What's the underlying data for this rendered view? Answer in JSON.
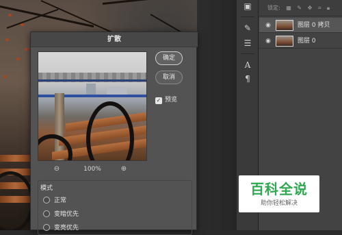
{
  "dialog": {
    "title": "扩散",
    "ok_label": "确定",
    "cancel_label": "取消",
    "preview_label": "预览",
    "preview_checked": true,
    "zoom_value": "100%",
    "mode": {
      "title": "模式",
      "options": [
        "正常",
        "变暗优先",
        "变亮优先"
      ]
    }
  },
  "layers_panel": {
    "lock_label": "锁定:",
    "layers": [
      {
        "name": "图层 0 拷贝",
        "visible": true,
        "selected": true
      },
      {
        "name": "图层 0",
        "visible": true,
        "selected": false
      }
    ]
  },
  "tools": {
    "icons": [
      "layer-comps-icon",
      "brush-settings-icon",
      "adjustments-icon",
      "character-icon",
      "paragraph-icon"
    ]
  },
  "watermark": {
    "title": "百科全说",
    "subtitle": "助你轻松解决"
  }
}
